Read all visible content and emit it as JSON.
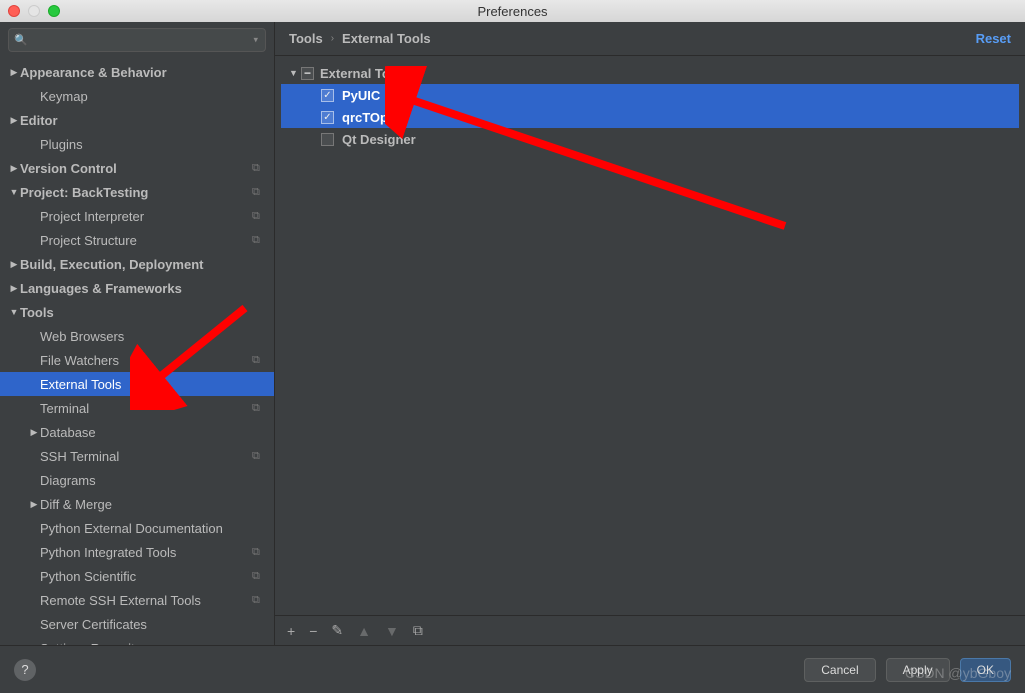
{
  "window": {
    "title": "Preferences"
  },
  "search": {
    "placeholder": ""
  },
  "breadcrumb": {
    "root": "Tools",
    "current": "External Tools",
    "reset": "Reset"
  },
  "sidebar": {
    "items": [
      {
        "label": "Appearance & Behavior",
        "level": 0,
        "arrow": "▶",
        "trail": false
      },
      {
        "label": "Keymap",
        "level": 1,
        "arrow": "",
        "trail": false
      },
      {
        "label": "Editor",
        "level": 0,
        "arrow": "▶",
        "trail": false
      },
      {
        "label": "Plugins",
        "level": 1,
        "arrow": "",
        "trail": false
      },
      {
        "label": "Version Control",
        "level": 0,
        "arrow": "▶",
        "trail": true
      },
      {
        "label": "Project: BackTesting",
        "level": 0,
        "arrow": "▼",
        "trail": true
      },
      {
        "label": "Project Interpreter",
        "level": 1,
        "arrow": "",
        "trail": true
      },
      {
        "label": "Project Structure",
        "level": 1,
        "arrow": "",
        "trail": true
      },
      {
        "label": "Build, Execution, Deployment",
        "level": 0,
        "arrow": "▶",
        "trail": false
      },
      {
        "label": "Languages & Frameworks",
        "level": 0,
        "arrow": "▶",
        "trail": false
      },
      {
        "label": "Tools",
        "level": 0,
        "arrow": "▼",
        "trail": false
      },
      {
        "label": "Web Browsers",
        "level": 1,
        "arrow": "",
        "trail": false
      },
      {
        "label": "File Watchers",
        "level": 1,
        "arrow": "",
        "trail": true
      },
      {
        "label": "External Tools",
        "level": 1,
        "arrow": "",
        "trail": false,
        "selected": true
      },
      {
        "label": "Terminal",
        "level": 1,
        "arrow": "",
        "trail": true
      },
      {
        "label": "Database",
        "level": 1,
        "arrow": "▶",
        "trail": false
      },
      {
        "label": "SSH Terminal",
        "level": 1,
        "arrow": "",
        "trail": true
      },
      {
        "label": "Diagrams",
        "level": 1,
        "arrow": "",
        "trail": false
      },
      {
        "label": "Diff & Merge",
        "level": 1,
        "arrow": "▶",
        "trail": false
      },
      {
        "label": "Python External Documentation",
        "level": 1,
        "arrow": "",
        "trail": false
      },
      {
        "label": "Python Integrated Tools",
        "level": 1,
        "arrow": "",
        "trail": true
      },
      {
        "label": "Python Scientific",
        "level": 1,
        "arrow": "",
        "trail": true
      },
      {
        "label": "Remote SSH External Tools",
        "level": 1,
        "arrow": "",
        "trail": true
      },
      {
        "label": "Server Certificates",
        "level": 1,
        "arrow": "",
        "trail": false
      },
      {
        "label": "Settings Repository",
        "level": 1,
        "arrow": "",
        "trail": false
      }
    ]
  },
  "external_tools": {
    "group_label": "External Tools",
    "items": [
      {
        "label": "PyUIC",
        "checked": true,
        "selected": true
      },
      {
        "label": "qrcTOpy",
        "checked": true,
        "selected": true
      },
      {
        "label": "Qt Designer",
        "checked": false,
        "selected": false
      }
    ]
  },
  "toolbar": {
    "add": "+",
    "remove": "−",
    "edit": "✎",
    "up": "▲",
    "down": "▼",
    "copy": "⧉"
  },
  "footer": {
    "help": "?",
    "cancel": "Cancel",
    "apply": "Apply",
    "ok": "OK"
  },
  "watermark": "CSDN @ybGboy"
}
